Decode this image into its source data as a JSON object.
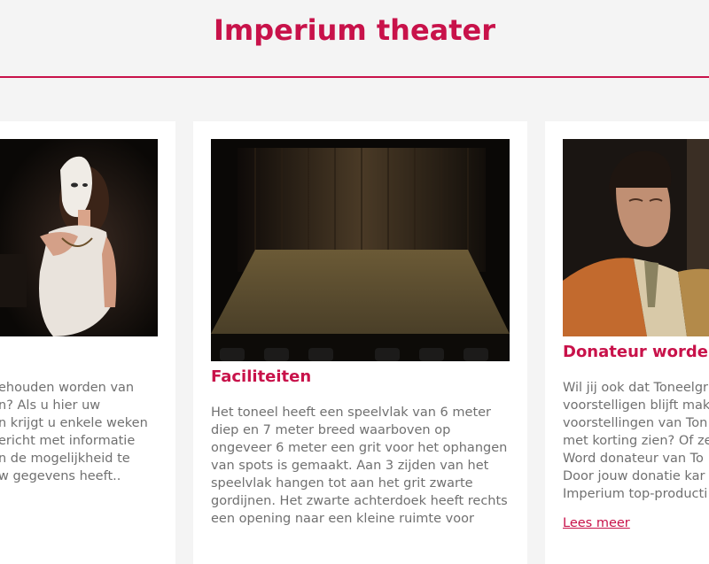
{
  "header": {
    "title": "Imperium theater"
  },
  "cards": {
    "left": {
      "lines": [
        "ehouden worden van",
        "n? Als u hier uw",
        "n krijgt u enkele weken",
        "ericht met informatie",
        "n de mogelijkheid te",
        "w gegevens heeft.."
      ]
    },
    "mid": {
      "title": "Faciliteiten",
      "lines": [
        "Het toneel heeft een speelvlak van 6 meter",
        "diep en 7 meter breed waarboven op",
        "ongeveer 6 meter een grit voor het ophangen",
        "van spots is gemaakt. Aan 3 zijden van het",
        "speelvlak hangen tot aan het grit zwarte",
        "gordijnen. Het zwarte achterdoek heeft rechts",
        "een opening naar een kleine ruimte voor"
      ]
    },
    "right": {
      "title": "Donateur worden",
      "lines": [
        "Wil jij ook dat Toneelgr",
        "voorstelligen blijft mak",
        "voorstellingen van Ton",
        "met korting zien? Of ze",
        "Word donateur van To",
        "Door jouw donatie kar",
        "Imperium top-producti"
      ],
      "read_more": "Lees meer"
    }
  },
  "colors": {
    "accent": "#c8124a",
    "text": "#707070",
    "background": "#f4f4f4",
    "card": "#ffffff"
  }
}
